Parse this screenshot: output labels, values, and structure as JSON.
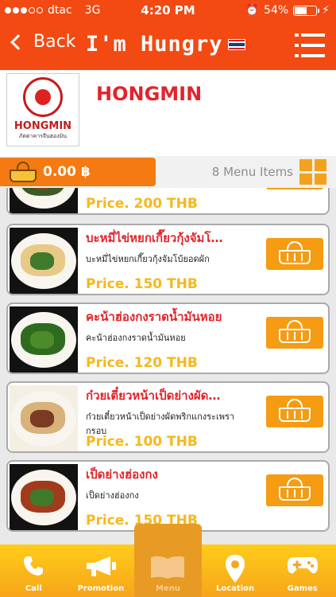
{
  "status": {
    "carrier": "dtac",
    "network": "3G",
    "time": "4:20 PM",
    "battery": "54%"
  },
  "nav": {
    "back_label": "Back",
    "app_name": "I'm Hungry",
    "flag_colors": [
      "#d3232b",
      "#ffffff",
      "#1b3c8c",
      "#ffffff",
      "#d3232b"
    ]
  },
  "restaurant": {
    "name": "HONGMIN",
    "logo_name": "HONGMIN",
    "logo_sub": "ภัตตาคารจีนฮองมิน"
  },
  "cart": {
    "total": "0.00 ฿",
    "menu_count": "8 Menu Items"
  },
  "menu": {
    "items": [
      {
        "name": "",
        "desc": "",
        "price": "Price. 200 THB"
      },
      {
        "name": "บะหมี่ไข่หยกเกี๊ยวกุ้งจัมโ…",
        "desc": "บะหมี่ไข่หยกเกี๊ยวกุ้งจัมโบ้ยอดผัก",
        "price": "Price. 150 THB"
      },
      {
        "name": "คะน้าฮ่องกงราดน้ำมันหอย",
        "desc": "คะน้าฮ่องกงราดน้ำมันหอย",
        "price": "Price. 120 THB"
      },
      {
        "name": "ก๋วยเตี๋ยวหน้าเป็ดย่างผัด…",
        "desc": "ก๋วยเตี๋ยวหน้าเป็ดย่างผัดพริกแกงระเพรากรอบ",
        "price": "Price. 100 THB"
      },
      {
        "name": "เป็ดย่างฮ่องกง",
        "desc": "เป็ดย่างฮ่องกง",
        "price": "Price. 150 THB"
      }
    ]
  },
  "tabs": [
    {
      "label": "Call",
      "icon": "phone-icon"
    },
    {
      "label": "Promotion",
      "icon": "megaphone-icon"
    },
    {
      "label": "Menu",
      "icon": "book-icon",
      "active": true
    },
    {
      "label": "Location",
      "icon": "map-pin-icon"
    },
    {
      "label": "Games",
      "icon": "gamepad-icon"
    }
  ],
  "colors": {
    "header": "#f24a12",
    "accent_red": "#e3232b",
    "price": "#f5b81c",
    "add_button": "#f59c12"
  }
}
